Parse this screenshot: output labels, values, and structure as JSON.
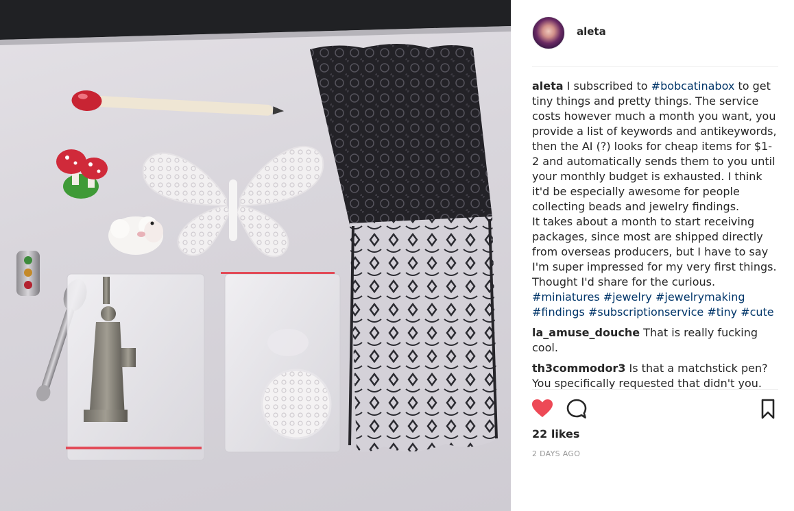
{
  "post": {
    "author": "aleta",
    "avatar_icon": "avatar-photo",
    "caption": {
      "username": "aleta",
      "parts": [
        {
          "t": "text",
          "v": " I subscribed to "
        },
        {
          "t": "tag",
          "v": "#bobcatinabox"
        },
        {
          "t": "text",
          "v": " to get tiny things and pretty things. The service costs however much a month you want, you provide a list of keywords and antikeywords, then the AI (?) looks for cheap items for $1-2 and automatically sends them to you until your monthly budget is exhausted. I think it'd be especially awesome for people collecting beads and jewelry findings."
        },
        {
          "t": "break",
          "v": ""
        },
        {
          "t": "text",
          "v": "It takes about a month to start receiving packages, since most are shipped directly from overseas producers, but I have to say I'm super impressed for my very first things. Thought I'd share for the curious."
        },
        {
          "t": "break",
          "v": ""
        },
        {
          "t": "tag",
          "v": "#miniatures"
        },
        {
          "t": "text",
          "v": " "
        },
        {
          "t": "tag",
          "v": "#jewelry"
        },
        {
          "t": "text",
          "v": " "
        },
        {
          "t": "tag",
          "v": "#jewelrymaking"
        },
        {
          "t": "text",
          "v": " "
        },
        {
          "t": "tag",
          "v": "#findings"
        },
        {
          "t": "text",
          "v": " "
        },
        {
          "t": "tag",
          "v": "#subscriptionservice"
        },
        {
          "t": "text",
          "v": " "
        },
        {
          "t": "tag",
          "v": "#tiny"
        },
        {
          "t": "text",
          "v": " "
        },
        {
          "t": "tag",
          "v": "#cute"
        }
      ]
    },
    "comments": [
      {
        "username": "la_amuse_douche",
        "text": " That is really fucking cool."
      },
      {
        "username": "th3commodor3",
        "text": " Is that a matchstick pen? You specifically requested that didn't you."
      }
    ],
    "likes": "22 likes",
    "date": "2 DAYS AGO",
    "icons": {
      "like": "heart-icon",
      "comment": "comment-bubble-icon",
      "save": "bookmark-icon"
    },
    "colors": {
      "like_filled": "#ed4956",
      "hashtag": "#003569",
      "timestamp": "#999999"
    }
  }
}
